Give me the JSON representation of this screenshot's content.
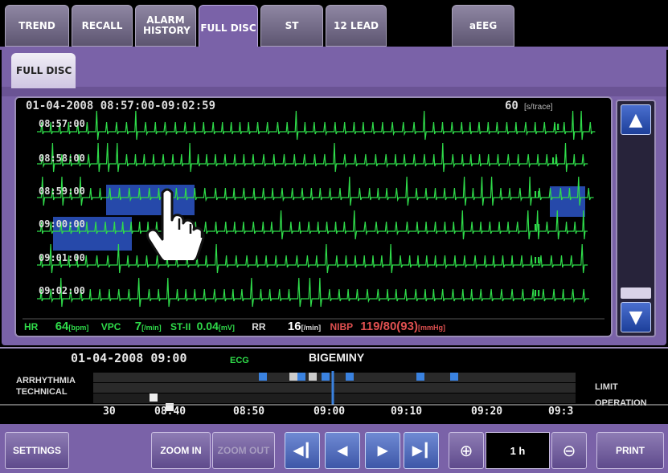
{
  "tabs": [
    {
      "label": "TREND"
    },
    {
      "label": "RECALL"
    },
    {
      "label": "ALARM HISTORY"
    },
    {
      "label": "FULL DISC"
    },
    {
      "label": "ST"
    },
    {
      "label": "12 LEAD"
    },
    {
      "label": "aEEG"
    }
  ],
  "subtab": {
    "label": "FULL DISC"
  },
  "waveform": {
    "range": "01-04-2008  08:57:00-09:02:59",
    "speed_value": "60",
    "speed_unit": "[s/trace]",
    "rows": [
      {
        "time": "08:57:00"
      },
      {
        "time": "08:58:00"
      },
      {
        "time": "08:59:00"
      },
      {
        "time": "09:00:00"
      },
      {
        "time": "09:01:00"
      },
      {
        "time": "09:02:00"
      }
    ],
    "lead_label": "II"
  },
  "vitals": {
    "hr_label": "HR",
    "hr_value": "64",
    "hr_unit": "[bpm]",
    "vpc_label": "VPC",
    "vpc_value": "7",
    "vpc_unit": "[/min]",
    "st_label": "ST-II",
    "st_value": "0.04",
    "st_unit": "[mV]",
    "rr_label": "RR",
    "rr_value": "16",
    "rr_unit": "[/min]",
    "nibp_label": "NIBP",
    "nibp_value": "119/80(93)",
    "nibp_unit": "[mmHg]"
  },
  "event": {
    "datetime": "01-04-2008  09:00",
    "source": "ECG",
    "name": "BIGEMINY"
  },
  "timeline": {
    "left_label_1": "ARRHYTHMIA",
    "left_label_2": "TECHNICAL",
    "right_label_1": "LIMIT",
    "right_label_2": "OPERATION",
    "ticks": [
      "30",
      "08:40",
      "08:50",
      "09:00",
      "09:10",
      "09:20",
      "09:3"
    ]
  },
  "toolbar": {
    "settings": "SETTINGS",
    "zoom_in": "ZOOM IN",
    "zoom_out": "ZOOM OUT",
    "zoom_level": "1 h",
    "print": "PRINT"
  },
  "colors": {
    "ecg": "#2fdc4a",
    "highlight": "#2d56c8",
    "panel": "#7a62a8",
    "event_marker": "#3a82e0"
  },
  "icons": [
    "up-arrow-icon",
    "down-arrow-icon",
    "first-icon",
    "prev-icon",
    "next-icon",
    "last-icon",
    "zoom-plus-icon",
    "zoom-minus-icon",
    "hand-pointer-icon"
  ]
}
